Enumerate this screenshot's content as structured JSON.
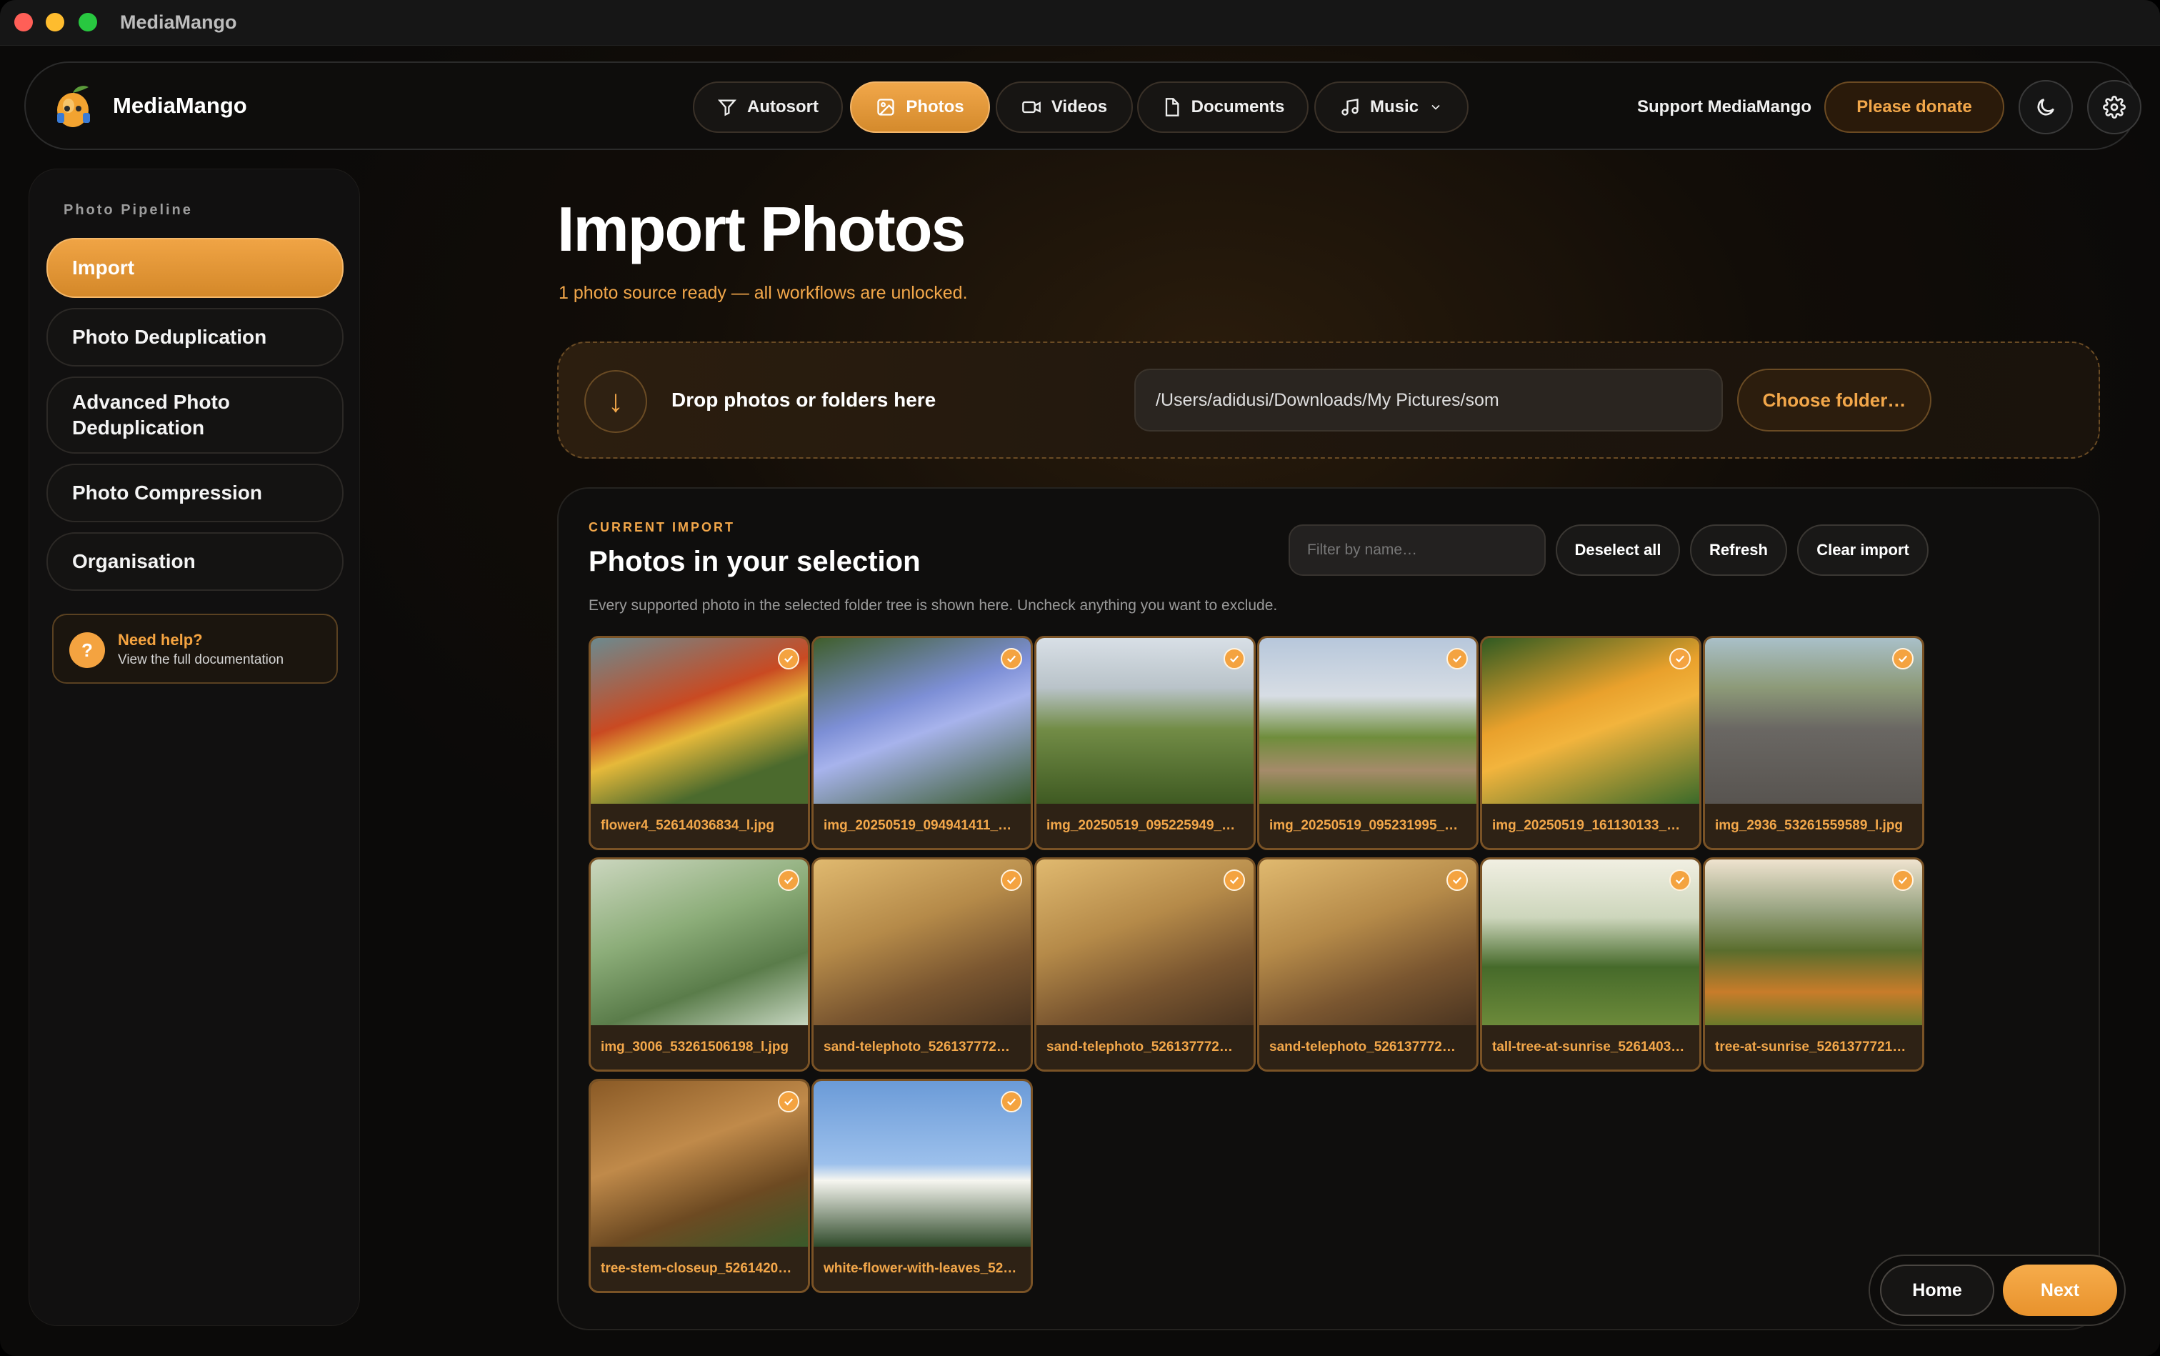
{
  "window": {
    "title": "MediaMango"
  },
  "brand": {
    "name": "MediaMango"
  },
  "nav": {
    "tabs": [
      {
        "label": "Autosort",
        "icon": "filter-icon"
      },
      {
        "label": "Photos",
        "icon": "image-icon",
        "active": true
      },
      {
        "label": "Videos",
        "icon": "video-icon"
      },
      {
        "label": "Documents",
        "icon": "document-icon"
      },
      {
        "label": "Music",
        "icon": "music-icon"
      }
    ],
    "support_label": "Support MediaMango",
    "donate_label": "Please donate"
  },
  "sidebar": {
    "heading": "Photo Pipeline",
    "items": [
      {
        "label": "Import",
        "active": true
      },
      {
        "label": "Photo Deduplication"
      },
      {
        "label": "Advanced Photo Deduplication"
      },
      {
        "label": "Photo Compression"
      },
      {
        "label": "Organisation"
      }
    ],
    "help": {
      "title": "Need help?",
      "subtitle": "View the full documentation"
    }
  },
  "main": {
    "title": "Import Photos",
    "subtitle": "1 photo source ready — all workflows are unlocked.",
    "drop": {
      "label": "Drop photos or folders here",
      "path_value": "/Users/adidusi/Downloads/My Pictures/som",
      "choose_label": "Choose folder…"
    },
    "selection": {
      "eyebrow": "CURRENT IMPORT",
      "title": "Photos in your selection",
      "description": "Every supported photo in the selected folder tree is shown here. Uncheck anything you want to exclude.",
      "filter_placeholder": "Filter by name…",
      "buttons": {
        "deselect": "Deselect all",
        "refresh": "Refresh",
        "clear": "Clear import"
      },
      "photos": [
        {
          "name": "flower4_52614036834_l.jpg",
          "checked": true
        },
        {
          "name": "img_20250519_094941411_…",
          "checked": true
        },
        {
          "name": "img_20250519_095225949_…",
          "checked": true
        },
        {
          "name": "img_20250519_095231995_…",
          "checked": true
        },
        {
          "name": "img_20250519_161130133_…",
          "checked": true
        },
        {
          "name": "img_2936_53261559589_l.jpg",
          "checked": true
        },
        {
          "name": "img_3006_53261506198_l.jpg",
          "checked": true
        },
        {
          "name": "sand-telephoto_526137772…",
          "checked": true
        },
        {
          "name": "sand-telephoto_526137772…",
          "checked": true
        },
        {
          "name": "sand-telephoto_526137772…",
          "checked": true
        },
        {
          "name": "tall-tree-at-sunrise_5261403…",
          "checked": true
        },
        {
          "name": "tree-at-sunrise_5261377721…",
          "checked": true
        },
        {
          "name": "tree-stem-closeup_5261420…",
          "checked": true
        },
        {
          "name": "white-flower-with-leaves_52…",
          "checked": true
        }
      ]
    }
  },
  "footer": {
    "home_label": "Home",
    "next_label": "Next"
  },
  "colors": {
    "accent": "#f2a74a",
    "background": "#0b0a09"
  }
}
